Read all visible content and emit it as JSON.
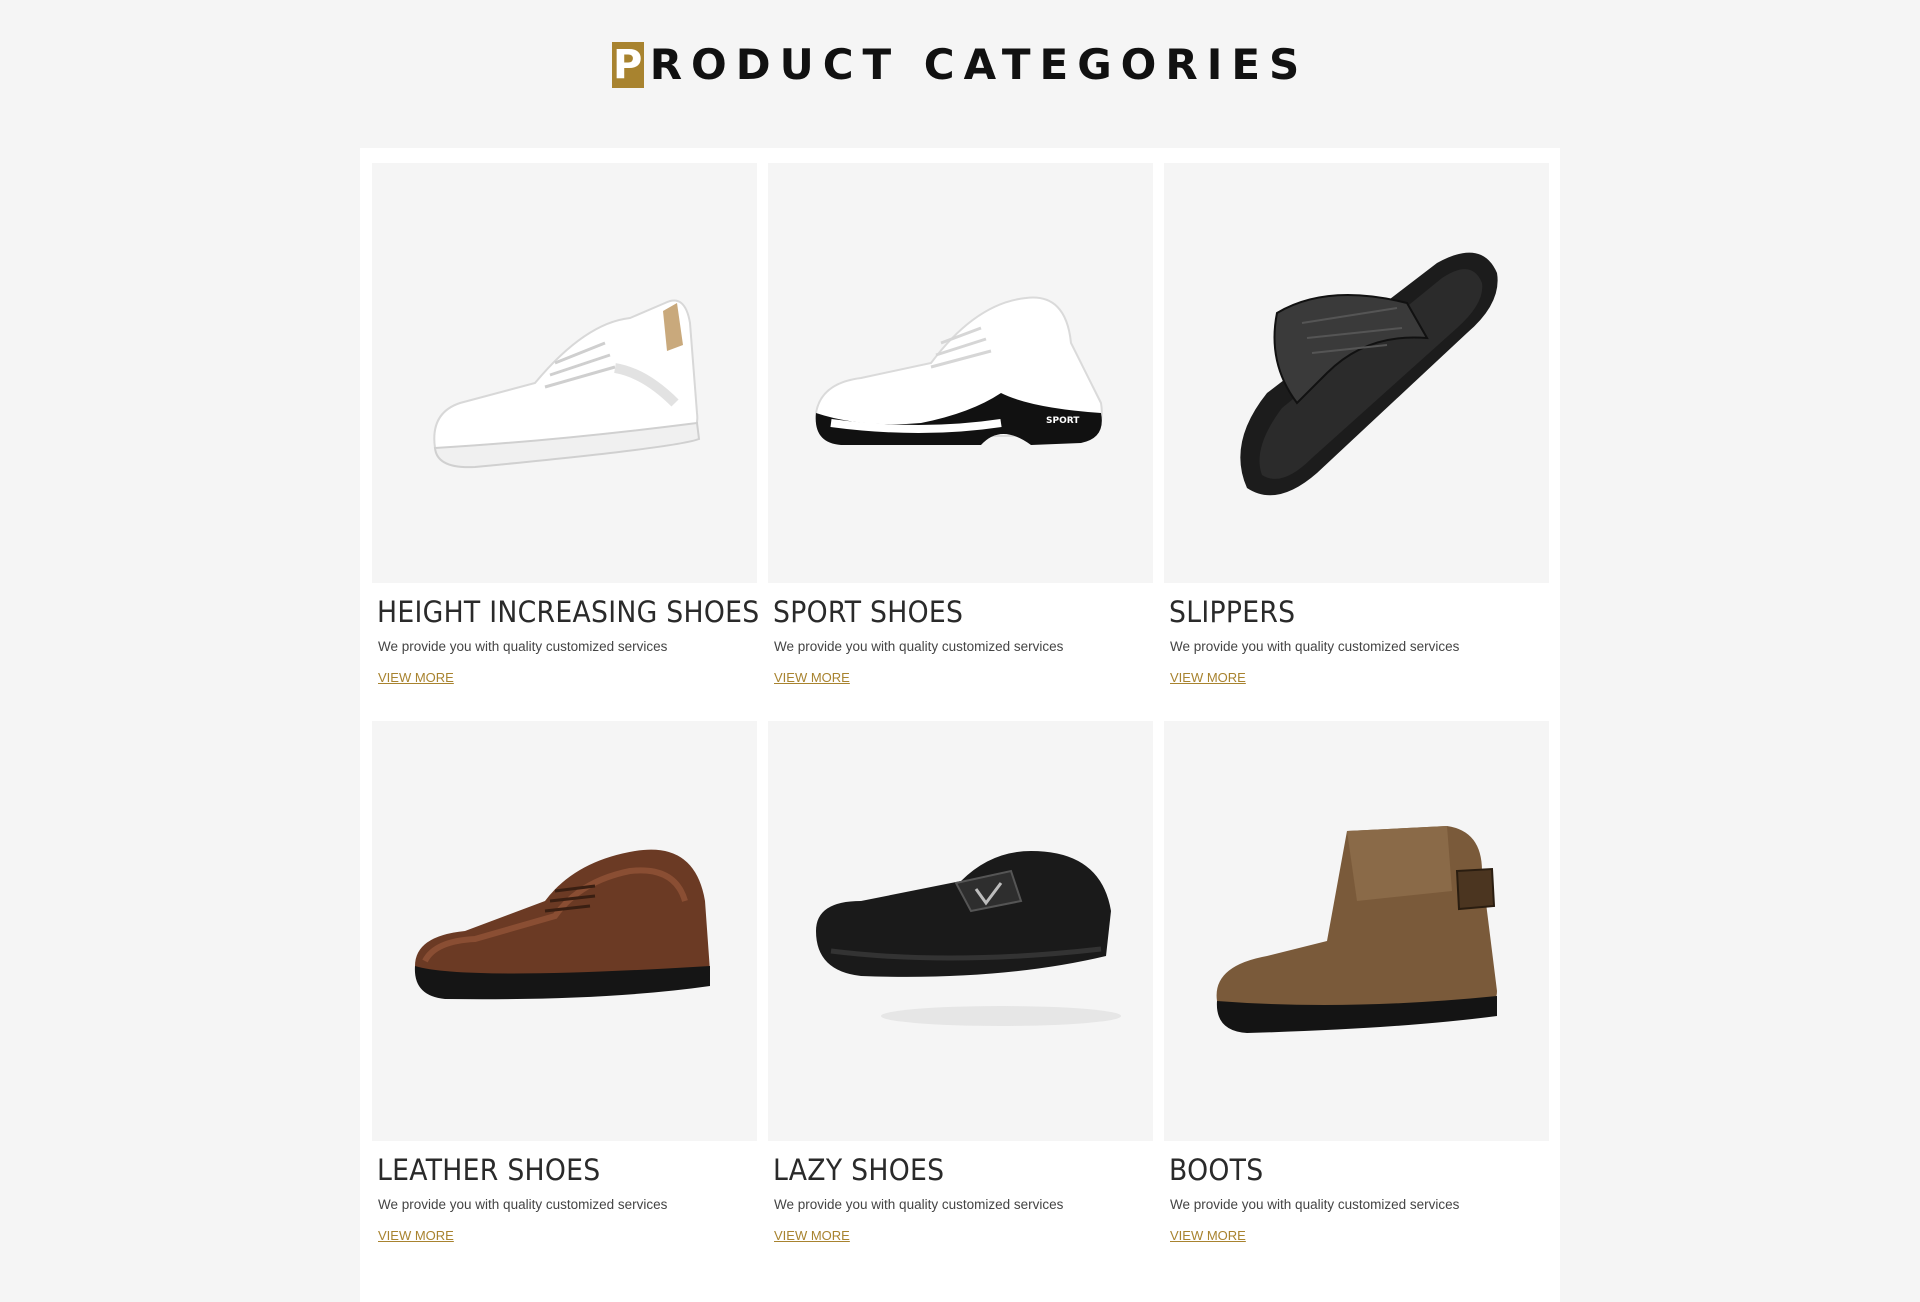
{
  "header": {
    "title_first": "P",
    "title_rest": "RODUCT CATEGORIES"
  },
  "categories": [
    {
      "name": "HEIGHT INCREASING SHOES",
      "desc": "We provide you with quality customized services",
      "link": "VIEW MORE",
      "icon": "white-sneaker-image"
    },
    {
      "name": "SPORT SHOES",
      "desc": "We provide you with quality customized services",
      "link": "VIEW MORE",
      "icon": "sport-shoe-image"
    },
    {
      "name": "SLIPPERS",
      "desc": "We provide you with quality customized services",
      "link": "VIEW MORE",
      "icon": "flip-flop-image"
    },
    {
      "name": "LEATHER SHOES",
      "desc": "We provide you with quality customized services",
      "link": "VIEW MORE",
      "icon": "brown-oxford-image"
    },
    {
      "name": "LAZY SHOES",
      "desc": "We provide you with quality customized services",
      "link": "VIEW MORE",
      "icon": "black-loafer-image"
    },
    {
      "name": "BOOTS",
      "desc": "We provide you with quality customized services",
      "link": "VIEW MORE",
      "icon": "brown-boot-image"
    }
  ],
  "colors": {
    "accent": "#a8832f",
    "background": "#f5f5f5",
    "panel": "#ffffff"
  }
}
